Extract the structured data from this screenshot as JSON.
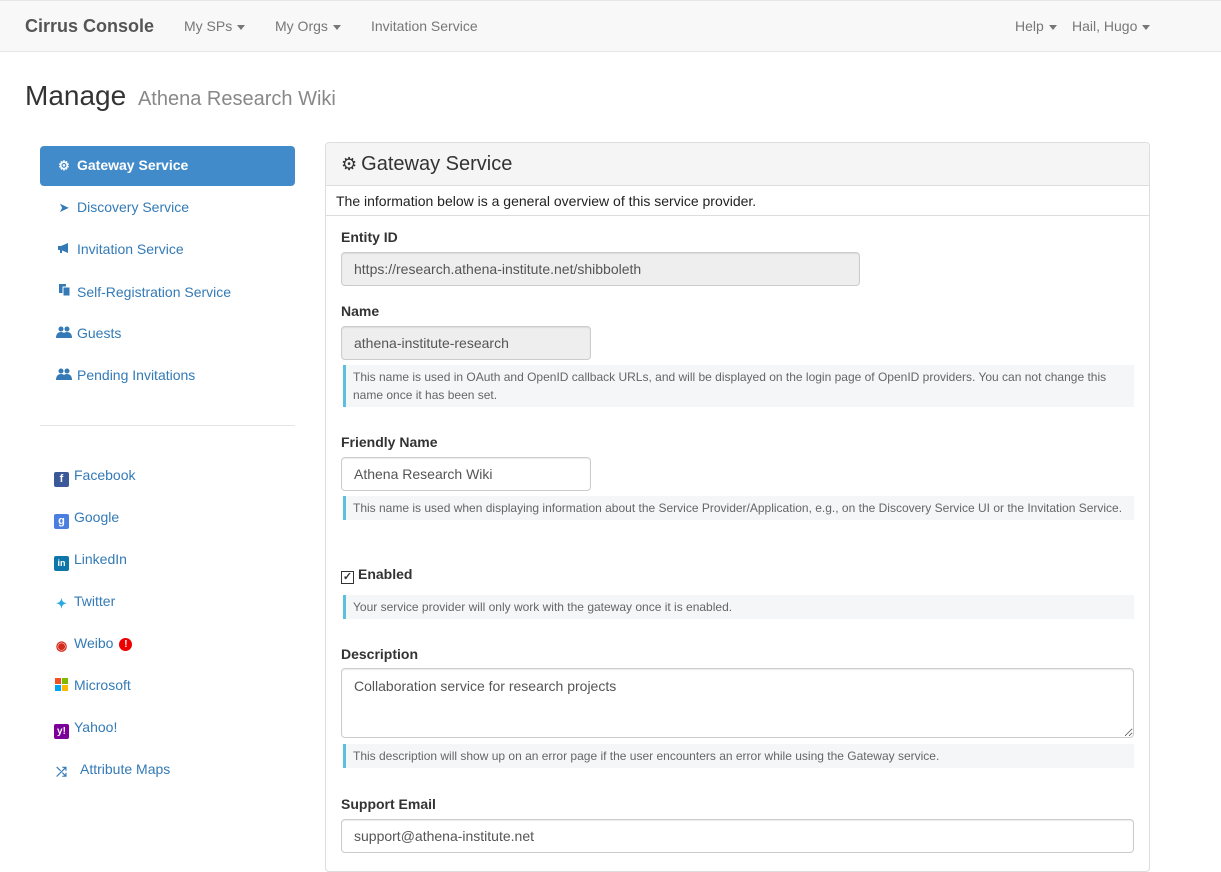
{
  "nav": {
    "brand": "Cirrus Console",
    "my_sps": "My SPs",
    "my_orgs": "My Orgs",
    "invitation_service": "Invitation Service",
    "help": "Help",
    "user": "Hail, Hugo"
  },
  "header": {
    "title": "Manage",
    "subtitle": "Athena Research Wiki"
  },
  "sidebar": {
    "items": [
      {
        "label": "Gateway Service",
        "icon": "gear-icon",
        "active": true
      },
      {
        "label": "Discovery Service",
        "icon": "location-arrow-icon"
      },
      {
        "label": "Invitation Service",
        "icon": "bullhorn-icon"
      },
      {
        "label": "Self-Registration Service",
        "icon": "copy-icon"
      },
      {
        "label": "Guests",
        "icon": "users-icon"
      },
      {
        "label": "Pending Invitations",
        "icon": "users-icon"
      }
    ],
    "social": [
      {
        "label": "Facebook",
        "icon": "facebook-icon"
      },
      {
        "label": "Google",
        "icon": "google-icon"
      },
      {
        "label": "LinkedIn",
        "icon": "linkedin-icon"
      },
      {
        "label": "Twitter",
        "icon": "twitter-icon"
      },
      {
        "label": "Weibo",
        "icon": "weibo-icon",
        "alert": "!"
      },
      {
        "label": "Microsoft",
        "icon": "windows-icon"
      },
      {
        "label": "Yahoo!",
        "icon": "yahoo-icon"
      },
      {
        "label": "Attribute Maps",
        "icon": "random-icon"
      }
    ]
  },
  "panel": {
    "title": "Gateway Service",
    "intro": "The information below is a general overview of this service provider.",
    "entity_id": {
      "label": "Entity ID",
      "value": "https://research.athena-institute.net/shibboleth"
    },
    "name": {
      "label": "Name",
      "value": "athena-institute-research",
      "help": "This name is used in OAuth and OpenID callback URLs, and will be displayed on the login page of OpenID providers. You can not change this name once it has been set."
    },
    "friendly_name": {
      "label": "Friendly Name",
      "value": "Athena Research Wiki",
      "help": "This name is used when displaying information about the Service Provider/Application, e.g., on the Discovery Service UI or the Invitation Service."
    },
    "enabled": {
      "label": "Enabled",
      "checked": true,
      "help": "Your service provider will only work with the gateway once it is enabled."
    },
    "description": {
      "label": "Description",
      "value": "Collaboration service for research projects",
      "help": "This description will show up on an error page if the user encounters an error while using the Gateway service."
    },
    "support_email": {
      "label": "Support Email",
      "value": "support@athena-institute.net"
    }
  },
  "colors": {
    "active_bg": "#428bca",
    "link": "#337ab7",
    "help_border": "#5bc0de"
  }
}
